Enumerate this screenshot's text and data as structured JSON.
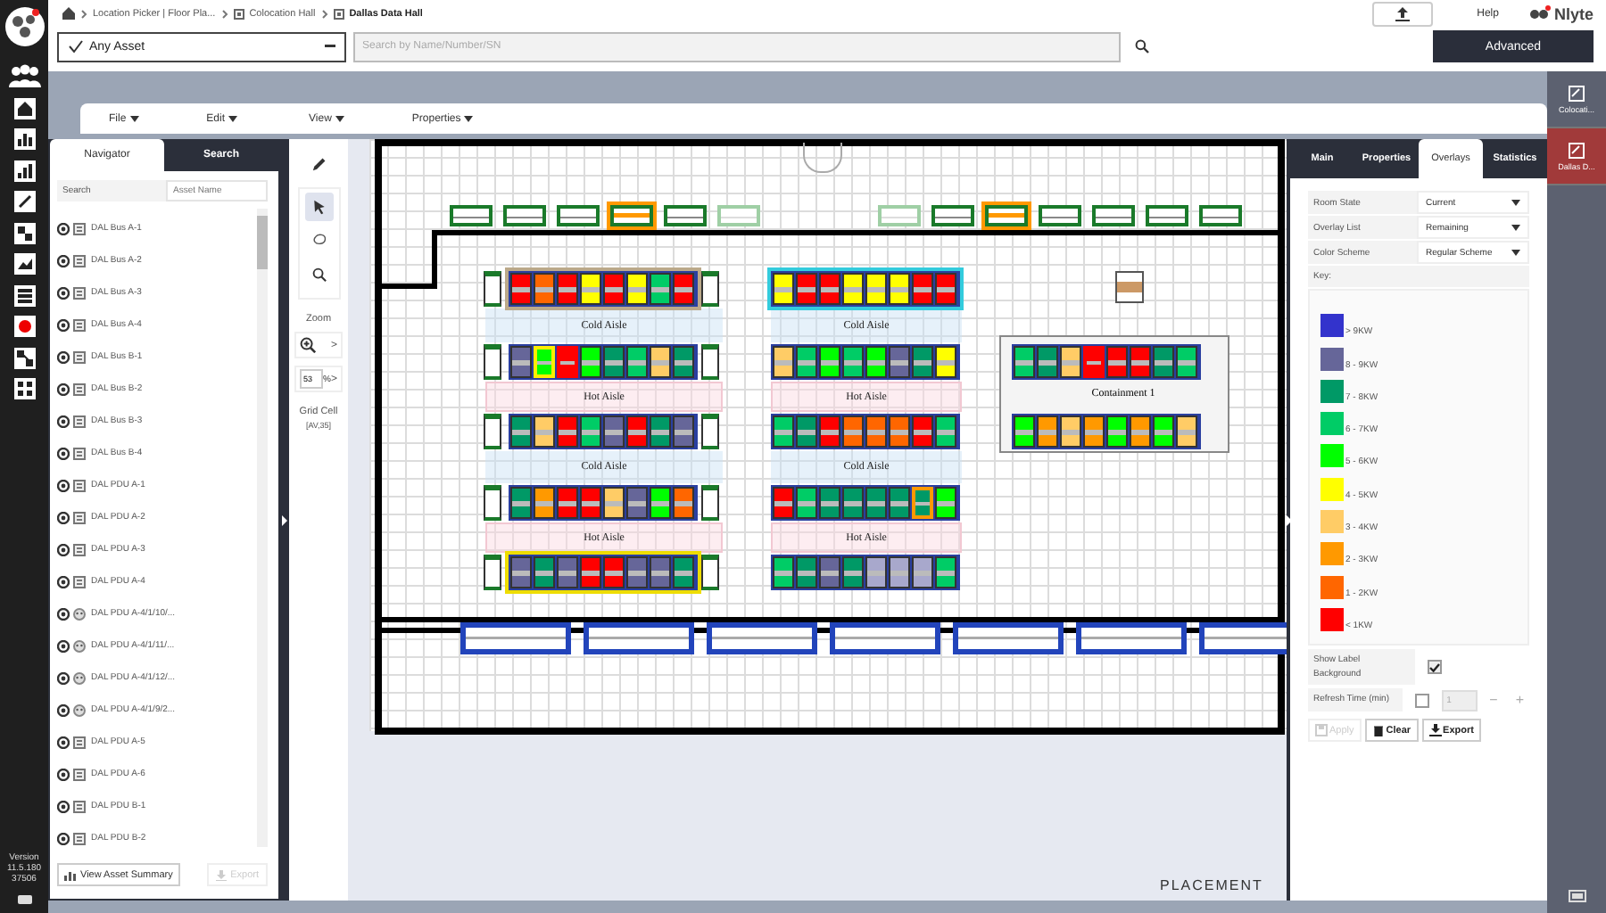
{
  "sidebar": {
    "version_lines": [
      "Version",
      "11.5.180",
      "37506"
    ]
  },
  "breadcrumb": [
    {
      "label": "Location Picker | Floor Pla...",
      "selected": false,
      "kind": "text"
    },
    {
      "label": "Colocation Hall",
      "selected": false,
      "kind": "hall"
    },
    {
      "label": "Dallas Data Hall",
      "selected": true,
      "kind": "hall"
    }
  ],
  "header": {
    "help": "Help",
    "logo": "Nlyte",
    "asset_filter": "Any Asset",
    "search_placeholder": "Search by Name/Number/SN",
    "advanced_button": "Advanced"
  },
  "menu": [
    "File",
    "Edit",
    "View",
    "Properties"
  ],
  "navigator": {
    "tabs": [
      {
        "label": "Navigator",
        "selected": true
      },
      {
        "label": "Search",
        "selected": false
      }
    ],
    "search_label": "Search",
    "search_placeholder": "Asset Name",
    "items": [
      {
        "label": "DAL Bus A-1",
        "kind": "panel"
      },
      {
        "label": "DAL Bus A-2",
        "kind": "panel"
      },
      {
        "label": "DAL Bus A-3",
        "kind": "panel"
      },
      {
        "label": "DAL Bus A-4",
        "kind": "panel"
      },
      {
        "label": "DAL Bus B-1",
        "kind": "panel"
      },
      {
        "label": "DAL Bus B-2",
        "kind": "panel"
      },
      {
        "label": "DAL Bus B-3",
        "kind": "panel"
      },
      {
        "label": "DAL Bus B-4",
        "kind": "panel"
      },
      {
        "label": "DAL PDU A-1",
        "kind": "panel"
      },
      {
        "label": "DAL PDU A-2",
        "kind": "panel"
      },
      {
        "label": "DAL PDU A-3",
        "kind": "panel"
      },
      {
        "label": "DAL PDU A-4",
        "kind": "panel"
      },
      {
        "label": "DAL PDU A-4/1/10/...",
        "kind": "outlet"
      },
      {
        "label": "DAL PDU A-4/1/11/...",
        "kind": "outlet"
      },
      {
        "label": "DAL PDU A-4/1/12/...",
        "kind": "outlet"
      },
      {
        "label": "DAL PDU A-4/1/9/2...",
        "kind": "outlet"
      },
      {
        "label": "DAL PDU A-5",
        "kind": "panel"
      },
      {
        "label": "DAL PDU A-6",
        "kind": "panel"
      },
      {
        "label": "DAL PDU B-1",
        "kind": "panel"
      },
      {
        "label": "DAL PDU B-2",
        "kind": "panel"
      }
    ],
    "summary_button": "View Asset Summary",
    "export_button": {
      "label": "Export",
      "disabled": true
    }
  },
  "tools": {
    "items": [
      {
        "kind": "pencil",
        "selected": false
      },
      {
        "kind": "pointer",
        "selected": true
      },
      {
        "kind": "lasso",
        "selected": false
      },
      {
        "kind": "search",
        "selected": false
      }
    ],
    "zoom_label": "Zoom",
    "zoom_arrow": ">",
    "zoom_value": "53",
    "percent": "%",
    "percent_arrow": ">",
    "grid_label": "Grid Cell",
    "grid_value": "[AV,35]"
  },
  "floor_plan": {
    "top_units": [
      {
        "kind": "normal"
      },
      {
        "kind": "normal"
      },
      {
        "kind": "normal"
      },
      {
        "kind": "highlight"
      },
      {
        "kind": "normal"
      },
      {
        "kind": "faded"
      },
      {
        "kind": "empty"
      },
      {
        "kind": "empty"
      },
      {
        "kind": "faded"
      },
      {
        "kind": "normal"
      },
      {
        "kind": "highlight"
      },
      {
        "kind": "normal"
      },
      {
        "kind": "normal"
      },
      {
        "kind": "normal"
      },
      {
        "kind": "normal"
      }
    ],
    "rack_rows": [
      {
        "kind": "left",
        "outline": {
          "color": "#bba98a"
        },
        "racks": [
          {
            "color": "#ff0000"
          },
          {
            "color": "#ff6600"
          },
          {
            "color": "#ff0000"
          },
          {
            "color": "#ffff00"
          },
          {
            "color": "#ff0000"
          },
          {
            "color": "#ffff00"
          },
          {
            "color": "#00cc66"
          },
          {
            "color": "#ff0000"
          }
        ]
      },
      {
        "kind": "left",
        "racks": [
          {
            "color": "#666699"
          },
          {
            "color": "#00ff00",
            "outline": {
              "color": "#ffee00"
            }
          },
          {
            "color": "#ff0000",
            "outline": {
              "color": "#ff0000"
            }
          },
          {
            "color": "#00ff00"
          },
          {
            "color": "#009966"
          },
          {
            "color": "#00cc66"
          },
          {
            "color": "#ffcc66"
          },
          {
            "color": "#009966"
          }
        ]
      },
      {
        "kind": "left",
        "racks": [
          {
            "color": "#009966"
          },
          {
            "color": "#ffcc66"
          },
          {
            "color": "#ff0000"
          },
          {
            "color": "#00cc66"
          },
          {
            "color": "#666699"
          },
          {
            "color": "#ff0000"
          },
          {
            "color": "#009966"
          },
          {
            "color": "#666699"
          }
        ]
      },
      {
        "kind": "left",
        "racks": [
          {
            "color": "#009966"
          },
          {
            "color": "#ff9900"
          },
          {
            "color": "#ff0000"
          },
          {
            "color": "#ff0000"
          },
          {
            "color": "#ffcc66"
          },
          {
            "color": "#666699"
          },
          {
            "color": "#00ff00"
          },
          {
            "color": "#ff6600"
          }
        ]
      },
      {
        "kind": "left",
        "outline": {
          "color": "#eedd00"
        },
        "racks": [
          {
            "color": "#666699"
          },
          {
            "color": "#009966"
          },
          {
            "color": "#666699"
          },
          {
            "color": "#ff0000"
          },
          {
            "color": "#ff0000"
          },
          {
            "color": "#666699"
          },
          {
            "color": "#666699"
          },
          {
            "color": "#009966"
          }
        ]
      },
      {
        "kind": "right",
        "outline": {
          "color": "#33ccdd"
        },
        "racks": [
          {
            "color": "#ffff00"
          },
          {
            "color": "#ff0000"
          },
          {
            "color": "#ff0000"
          },
          {
            "color": "#ffff00"
          },
          {
            "color": "#ffff00"
          },
          {
            "color": "#ffff00"
          },
          {
            "color": "#ff0000"
          },
          {
            "color": "#ff0000"
          }
        ]
      },
      {
        "kind": "right",
        "racks": [
          {
            "color": "#ffcc66"
          },
          {
            "color": "#00cc66"
          },
          {
            "color": "#00ff00"
          },
          {
            "color": "#00cc66"
          },
          {
            "color": "#00ff00"
          },
          {
            "color": "#666699"
          },
          {
            "color": "#009966"
          },
          {
            "color": "#ffff00"
          }
        ]
      },
      {
        "kind": "right",
        "racks": [
          {
            "color": "#00cc66"
          },
          {
            "color": "#009966"
          },
          {
            "color": "#ff0000"
          },
          {
            "color": "#ff6600"
          },
          {
            "color": "#ff6600"
          },
          {
            "color": "#ff6600"
          },
          {
            "color": "#ff0000"
          },
          {
            "color": "#00cc66"
          }
        ]
      },
      {
        "kind": "right",
        "racks": [
          {
            "color": "#ff0000"
          },
          {
            "color": "#00cc66"
          },
          {
            "color": "#009966"
          },
          {
            "color": "#009966"
          },
          {
            "color": "#009966"
          },
          {
            "color": "#009966"
          },
          {
            "color": "#009966",
            "outline": {
              "color": "#ff9900"
            }
          },
          {
            "color": "#00ff00"
          }
        ]
      },
      {
        "kind": "right",
        "racks": [
          {
            "color": "#00cc66"
          },
          {
            "color": "#009966"
          },
          {
            "color": "#666699"
          },
          {
            "color": "#009966"
          },
          {
            "color": "#a8a8cc"
          },
          {
            "color": "#a8a8cc"
          },
          {
            "color": "#a8a8cc"
          },
          {
            "color": "#00cc66"
          }
        ]
      },
      {
        "kind": "containment",
        "racks": [
          {
            "color": "#00cc66"
          },
          {
            "color": "#009966"
          },
          {
            "color": "#ffcc66"
          },
          {
            "color": "#ff0000",
            "outline": {
              "color": "#ff0000"
            }
          },
          {
            "color": "#ff0000"
          },
          {
            "color": "#ff0000"
          },
          {
            "color": "#009966"
          },
          {
            "color": "#00cc66"
          }
        ]
      },
      {
        "kind": "containment",
        "racks": [
          {
            "color": "#00ff00"
          },
          {
            "color": "#ff9900"
          },
          {
            "color": "#ffcc66"
          },
          {
            "color": "#ff9900"
          },
          {
            "color": "#00ff00"
          },
          {
            "color": "#ff9900"
          },
          {
            "color": "#00ff00"
          },
          {
            "color": "#ffcc66"
          }
        ]
      }
    ],
    "left_aisles": [
      {
        "label": "Cold Aisle",
        "kind": "cold"
      },
      {
        "label": "Hot Aisle",
        "kind": "hot"
      },
      {
        "label": "Cold Aisle",
        "kind": "cold"
      },
      {
        "label": "Hot Aisle",
        "kind": "hot"
      }
    ],
    "right_aisles": [
      {
        "label": "Cold Aisle",
        "kind": "cold"
      },
      {
        "label": "Hot Aisle",
        "kind": "hot"
      },
      {
        "label": "Cold Aisle",
        "kind": "cold"
      },
      {
        "label": "Hot Aisle",
        "kind": "hot"
      }
    ],
    "containment_label": "Containment 1",
    "footer_label": "PLACEMENT"
  },
  "overlays": {
    "tabs": [
      {
        "label": "Main",
        "selected": false
      },
      {
        "label": "Properties",
        "selected": false
      },
      {
        "label": "Overlays",
        "selected": true
      },
      {
        "label": "Statistics",
        "selected": false
      }
    ],
    "fields": [
      {
        "label": "Room State",
        "value": "Current"
      },
      {
        "label": "Overlay List",
        "value": "Remaining"
      },
      {
        "label": "Color Scheme",
        "value": "Regular Scheme"
      }
    ],
    "key_label": "Key:",
    "legend": [
      {
        "label": "> 9KW",
        "color": "#3333cc"
      },
      {
        "label": "8 - 9KW",
        "color": "#666699"
      },
      {
        "label": "7 - 8KW",
        "color": "#009966"
      },
      {
        "label": "6 - 7KW",
        "color": "#00cc66"
      },
      {
        "label": "5 - 6KW",
        "color": "#00ff00"
      },
      {
        "label": "4 - 5KW",
        "color": "#ffff00"
      },
      {
        "label": "3 - 4KW",
        "color": "#ffcc66"
      },
      {
        "label": "2 - 3KW",
        "color": "#ff9900"
      },
      {
        "label": "1 - 2KW",
        "color": "#ff6600"
      },
      {
        "label": "< 1KW",
        "color": "#ff0000"
      }
    ],
    "show_label": {
      "label": "Show Label Background",
      "checked": true
    },
    "refresh": {
      "label": "Refresh Time (min)",
      "checked": false,
      "value": "1",
      "minus": "−",
      "plus": "+"
    },
    "buttons": [
      {
        "label": "Apply",
        "kind": "apply",
        "disabled": true
      },
      {
        "label": "Clear",
        "kind": "clear",
        "disabled": false
      },
      {
        "label": "Export",
        "kind": "export",
        "disabled": false
      }
    ]
  },
  "windows": [
    {
      "label": "Colocati...",
      "selected": false
    },
    {
      "label": "Dallas D...",
      "selected": true
    }
  ]
}
